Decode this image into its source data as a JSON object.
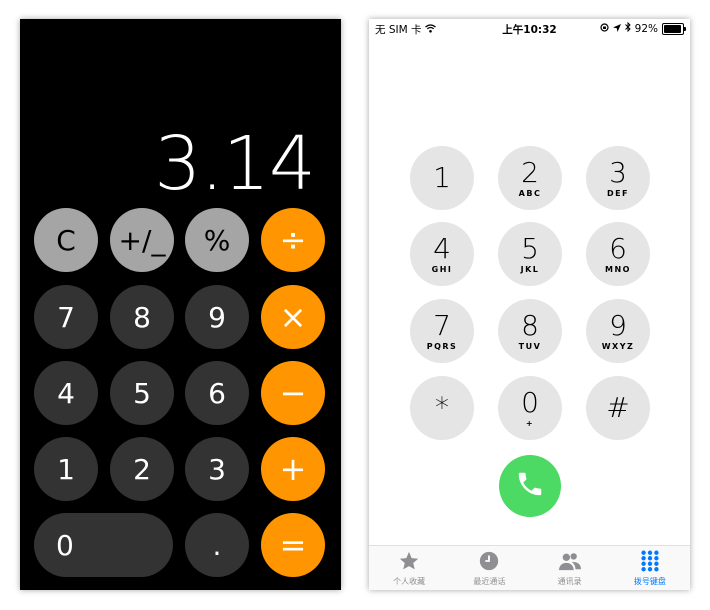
{
  "calculator": {
    "display": "3.14",
    "rows": [
      [
        {
          "label": "C",
          "kind": "fn",
          "name": "clear-button"
        },
        {
          "label": "+/_",
          "kind": "fn",
          "name": "sign-toggle-button"
        },
        {
          "label": "%",
          "kind": "fn",
          "name": "percent-button"
        },
        {
          "label": "÷",
          "kind": "op",
          "name": "divide-button"
        }
      ],
      [
        {
          "label": "7",
          "kind": "num",
          "name": "digit-7-button"
        },
        {
          "label": "8",
          "kind": "num",
          "name": "digit-8-button"
        },
        {
          "label": "9",
          "kind": "num",
          "name": "digit-9-button"
        },
        {
          "label": "×",
          "kind": "op",
          "name": "multiply-button"
        }
      ],
      [
        {
          "label": "4",
          "kind": "num",
          "name": "digit-4-button"
        },
        {
          "label": "5",
          "kind": "num",
          "name": "digit-5-button"
        },
        {
          "label": "6",
          "kind": "num",
          "name": "digit-6-button"
        },
        {
          "label": "−",
          "kind": "op",
          "name": "subtract-button"
        }
      ],
      [
        {
          "label": "1",
          "kind": "num",
          "name": "digit-1-button"
        },
        {
          "label": "2",
          "kind": "num",
          "name": "digit-2-button"
        },
        {
          "label": "3",
          "kind": "num",
          "name": "digit-3-button"
        },
        {
          "label": "+",
          "kind": "op",
          "name": "add-button"
        }
      ],
      [
        {
          "label": "0",
          "kind": "num",
          "name": "digit-0-button",
          "wide": true
        },
        {
          "label": ".",
          "kind": "num",
          "name": "decimal-button"
        },
        {
          "label": "=",
          "kind": "op",
          "name": "equals-button"
        }
      ]
    ],
    "colors": {
      "background": "#000000",
      "function_key": "#a5a5a5",
      "number_key": "#333333",
      "operator_key": "#ff9500"
    }
  },
  "phone": {
    "status_bar": {
      "carrier": "无 SIM 卡",
      "time": "上午10:32",
      "battery_percent": "92%",
      "battery_level": 0.92,
      "icons": [
        "wifi-icon",
        "orientation-lock-icon",
        "location-icon",
        "bluetooth-icon",
        "battery-icon"
      ]
    },
    "keypad": [
      {
        "digit": "1",
        "letters": ""
      },
      {
        "digit": "2",
        "letters": "ABC"
      },
      {
        "digit": "3",
        "letters": "DEF"
      },
      {
        "digit": "4",
        "letters": "GHI"
      },
      {
        "digit": "5",
        "letters": "JKL"
      },
      {
        "digit": "6",
        "letters": "MNO"
      },
      {
        "digit": "7",
        "letters": "PQRS"
      },
      {
        "digit": "8",
        "letters": "TUV"
      },
      {
        "digit": "9",
        "letters": "WXYZ"
      },
      {
        "digit": "*",
        "letters": ""
      },
      {
        "digit": "0",
        "letters": "+"
      },
      {
        "digit": "#",
        "letters": ""
      }
    ],
    "call_icon": "phone-icon",
    "tabs": [
      {
        "label": "个人收藏",
        "icon": "star-icon",
        "active": false
      },
      {
        "label": "最近通话",
        "icon": "clock-icon",
        "active": false
      },
      {
        "label": "通讯录",
        "icon": "contacts-icon",
        "active": false
      },
      {
        "label": "拨号键盘",
        "icon": "keypad-icon",
        "active": true
      }
    ],
    "colors": {
      "key": "#e5e5e5",
      "call": "#4cd964",
      "active_tab": "#007aff",
      "inactive_tab": "#8e8e93"
    }
  }
}
